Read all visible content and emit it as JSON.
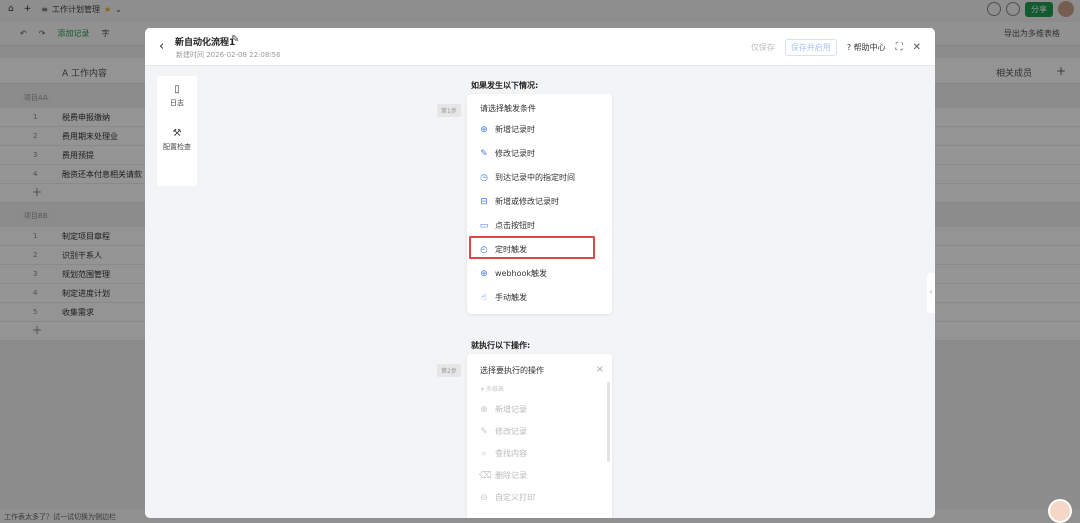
{
  "topbar": {
    "home_icon": "⌂",
    "plus_icon": "+",
    "menu_icon": "≡",
    "app_title": "工作计划管理",
    "star": "★",
    "dropdown": "⌄",
    "share_label": "分享"
  },
  "toolbar": {
    "undo": "↶",
    "redo": "↷",
    "add_record": "添加记录",
    "field_prefix": "字",
    "export_label": "导出为多维表格"
  },
  "table": {
    "task_header": "A 工作内容",
    "members_header": "相关成员",
    "add_col": "+",
    "group_a": "项目AA",
    "group_b": "项目BB",
    "rows_a": [
      {
        "num": "1",
        "text": "税费申报缴纳"
      },
      {
        "num": "2",
        "text": "费用期末处理业"
      },
      {
        "num": "3",
        "text": "费用预提"
      },
      {
        "num": "4",
        "text": "融资还本付息相关请款"
      }
    ],
    "rows_b": [
      {
        "num": "1",
        "text": "制定项目章程"
      },
      {
        "num": "2",
        "text": "识别干系人"
      },
      {
        "num": "3",
        "text": "规划范围管理"
      },
      {
        "num": "4",
        "text": "制定进度计划"
      },
      {
        "num": "5",
        "text": "收集需求"
      }
    ],
    "add_row": "+"
  },
  "footer": {
    "text": "工作表太多了？试一试切换为侧边栏"
  },
  "modal": {
    "back": "‹",
    "title": "新自动化流程1",
    "edit_icon": "✎",
    "created": "新建时间 2026-02-08 22:08:56",
    "save_only": "仅保存",
    "save_enable": "保存并启用",
    "help": "帮助中心",
    "help_icon": "?",
    "expand_icon": "⛶",
    "close_icon": "✕"
  },
  "side": {
    "log_label": "日志",
    "log_icon": "▯",
    "check_label": "配置检查",
    "check_icon": "⚒"
  },
  "trigger": {
    "title": "如果发生以下情况:",
    "step": "第1步",
    "header": "请选择触发条件",
    "options": [
      {
        "icon": "⊕",
        "label": "新增记录时"
      },
      {
        "icon": "✎",
        "label": "修改记录时"
      },
      {
        "icon": "◷",
        "label": "到达记录中的指定时间"
      },
      {
        "icon": "⊟",
        "label": "新增或修改记录时"
      },
      {
        "icon": "▭",
        "label": "点击按钮时"
      },
      {
        "icon": "◴",
        "label": "定时触发"
      },
      {
        "icon": "⊕",
        "label": "webhook触发"
      },
      {
        "icon": "☝",
        "label": "手动触发"
      }
    ]
  },
  "action": {
    "title": "就执行以下操作:",
    "step": "第2步",
    "header": "选择要执行的操作",
    "close": "×",
    "group": "▾ 多维表",
    "options": [
      {
        "icon": "⊕",
        "label": "新增记录"
      },
      {
        "icon": "✎",
        "label": "修改记录"
      },
      {
        "icon": "⌕",
        "label": "查找内容"
      },
      {
        "icon": "⌫",
        "label": "删除记录"
      },
      {
        "icon": "⊖",
        "label": "自定义打印"
      }
    ]
  },
  "colors": {
    "accent": "#4a7ee8",
    "highlight": "#e04848",
    "share": "#1f9d55"
  }
}
